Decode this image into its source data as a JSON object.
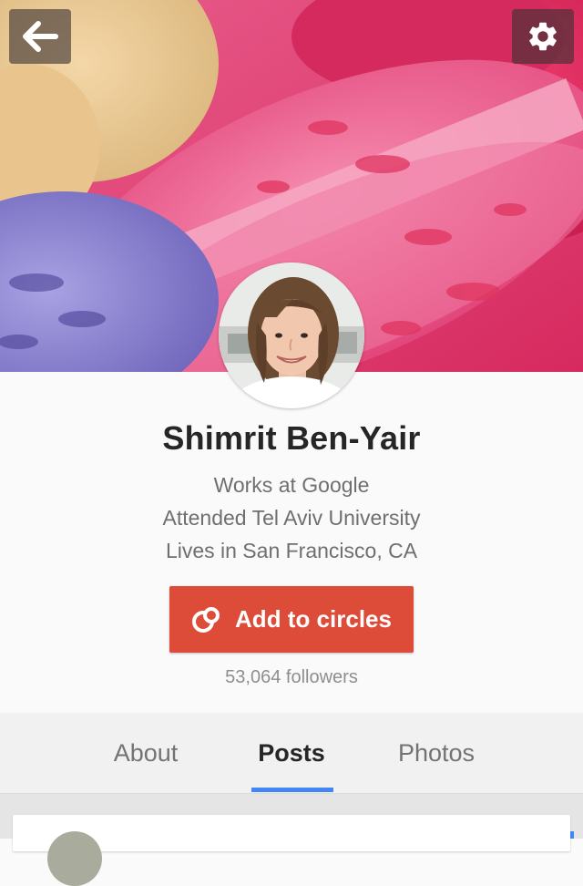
{
  "header": {
    "back_icon": "arrow-left-icon",
    "settings_icon": "gear-icon"
  },
  "profile": {
    "name": "Shimrit Ben-Yair",
    "work": "Works at Google",
    "education": "Attended Tel Aviv University",
    "location": "Lives in San Francisco, CA",
    "add_button_label": "Add to circles",
    "add_button_icon": "circles-icon",
    "followers": "53,064 followers"
  },
  "tabs": [
    {
      "label": "About",
      "active": false
    },
    {
      "label": "Posts",
      "active": true
    },
    {
      "label": "Photos",
      "active": false
    }
  ],
  "colors": {
    "add_button": "#dd4b39",
    "tab_indicator": "#4285f4",
    "name_text": "#262626",
    "detail_text": "#6f6f6f"
  }
}
